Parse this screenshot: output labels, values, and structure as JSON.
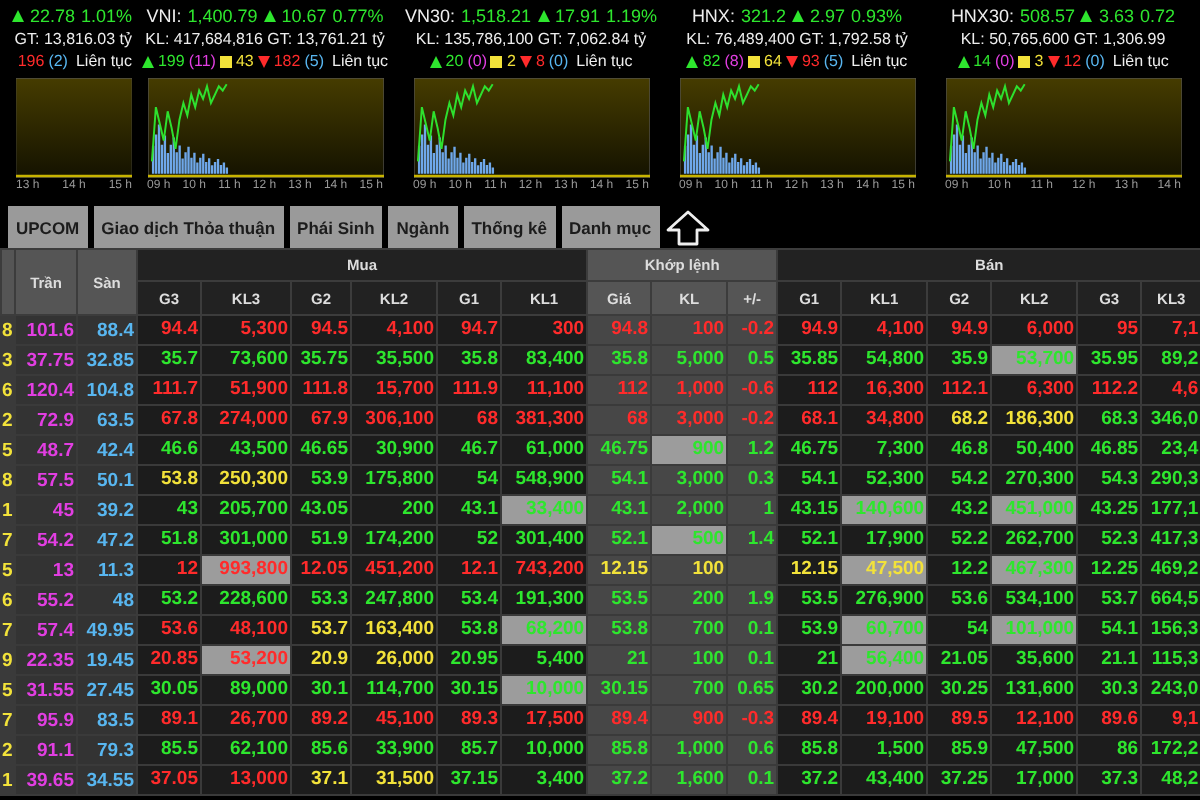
{
  "indices": [
    {
      "change": "22.78",
      "pct": "1.01%",
      "rising": true,
      "volume_line": "GT: 13,816.03 tỷ",
      "down": "196",
      "floor_count": "(2)",
      "status": "Liên tục",
      "times": [
        "13 h",
        "14 h",
        "15 h"
      ]
    },
    {
      "name": "VNI:",
      "value": "1,400.79",
      "rising": true,
      "change": "10.67",
      "pct": "0.77%",
      "volume_line": "KL: 417,684,816 GT: 13,761.21 tỷ",
      "up": "199",
      "ceil_count": "(11)",
      "flat": "43",
      "down": "182",
      "floor_count": "(5)",
      "status": "Liên tục",
      "times": [
        "09 h",
        "10 h",
        "11 h",
        "12 h",
        "13 h",
        "14 h",
        "15 h"
      ]
    },
    {
      "name": "VN30:",
      "value": "1,518.21",
      "rising": true,
      "change": "17.91",
      "pct": "1.19%",
      "volume_line": "KL: 135,786,100 GT: 7,062.84 tỷ",
      "up": "20",
      "ceil_count": "(0)",
      "flat": "2",
      "down": "8",
      "floor_count": "(0)",
      "status": "Liên tục",
      "times": [
        "09 h",
        "10 h",
        "11 h",
        "12 h",
        "13 h",
        "14 h",
        "15 h"
      ]
    },
    {
      "name": "HNX:",
      "value": "321.2",
      "rising": true,
      "change": "2.97",
      "pct": "0.93%",
      "volume_line": "KL: 76,489,400 GT: 1,792.58 tỷ",
      "up": "82",
      "ceil_count": "(8)",
      "flat": "64",
      "down": "93",
      "floor_count": "(5)",
      "status": "Liên tục",
      "times": [
        "09 h",
        "10 h",
        "11 h",
        "12 h",
        "13 h",
        "14 h",
        "15 h"
      ]
    },
    {
      "name": "HNX30:",
      "value": "508.57",
      "rising": true,
      "change": "3.63",
      "pct": "0.72",
      "volume_line": "KL: 50,765,600 GT: 1,306.99",
      "up": "14",
      "ceil_count": "(0)",
      "flat": "3",
      "down": "12",
      "floor_count": "(0)",
      "status": "Liên tục",
      "times": [
        "09 h",
        "10 h",
        "11 h",
        "12 h",
        "13 h",
        "14 h"
      ]
    }
  ],
  "tabs": [
    "UPCOM",
    "Giao dịch Thỏa thuận",
    "Phái Sinh",
    "Ngành",
    "Thống kê",
    "Danh mục"
  ],
  "table": {
    "ceiling_label": "Trần",
    "floor_label": "Sàn",
    "groups": [
      {
        "label": "Mua",
        "kind": "bid",
        "columns": [
          "G3",
          "KL3",
          "G2",
          "KL2",
          "G1",
          "KL1"
        ]
      },
      {
        "label": "Khớp lệnh",
        "kind": "match",
        "columns": [
          "Giá",
          "KL",
          "+/-"
        ]
      },
      {
        "label": "Bán",
        "kind": "ask",
        "columns": [
          "G1",
          "KL1",
          "G2",
          "KL2",
          "G3",
          "KL3"
        ]
      }
    ],
    "rows": [
      {
        "column_1": "8",
        "ceiling": "101.6",
        "floor": "88.4",
        "cells": [
          {
            "v": "94.4",
            "color": "#ff2b2b"
          },
          {
            "v": "5,300",
            "color": "#ff2b2b"
          },
          {
            "v": "94.5",
            "color": "#ff2b2b"
          },
          {
            "v": "4,100",
            "color": "#ff2b2b"
          },
          {
            "v": "94.7",
            "color": "#ff2b2b"
          },
          {
            "v": "300",
            "color": "#ff2b2b"
          },
          {
            "v": "94.8",
            "color": "#ff2b2b"
          },
          {
            "v": "100",
            "color": "#ff2b2b"
          },
          {
            "v": "-0.2",
            "color": "#ff2b2b"
          },
          {
            "v": "94.9",
            "color": "#ff2b2b"
          },
          {
            "v": "4,100",
            "color": "#ff2b2b"
          },
          {
            "v": "94.9",
            "color": "#ff2b2b"
          },
          {
            "v": "6,000",
            "color": "#ff2b2b"
          },
          {
            "v": "95",
            "color": "#ff2b2b"
          },
          {
            "v": "7,1",
            "color": "#ff2b2b"
          }
        ]
      },
      {
        "column_1": "3",
        "ceiling": "37.75",
        "floor": "32.85",
        "cells": [
          {
            "v": "35.7",
            "color": "#2ee62e"
          },
          {
            "v": "73,600",
            "color": "#2ee62e"
          },
          {
            "v": "35.75",
            "color": "#2ee62e"
          },
          {
            "v": "35,500",
            "color": "#2ee62e"
          },
          {
            "v": "35.8",
            "color": "#2ee62e"
          },
          {
            "v": "83,400",
            "color": "#2ee62e"
          },
          {
            "v": "35.8",
            "color": "#2ee62e"
          },
          {
            "v": "5,000",
            "color": "#2ee62e"
          },
          {
            "v": "0.5",
            "color": "#2ee62e"
          },
          {
            "v": "35.85",
            "color": "#2ee62e"
          },
          {
            "v": "54,800",
            "color": "#2ee62e"
          },
          {
            "v": "35.9",
            "color": "#2ee62e"
          },
          {
            "v": "53,700",
            "color": "#2ee62e",
            "hl": true
          },
          {
            "v": "35.95",
            "color": "#2ee62e"
          },
          {
            "v": "89,2",
            "color": "#2ee62e"
          }
        ]
      },
      {
        "column_1": "6",
        "ceiling": "120.4",
        "floor": "104.8",
        "cells": [
          {
            "v": "111.7",
            "color": "#ff2b2b"
          },
          {
            "v": "51,900",
            "color": "#ff2b2b"
          },
          {
            "v": "111.8",
            "color": "#ff2b2b"
          },
          {
            "v": "15,700",
            "color": "#ff2b2b"
          },
          {
            "v": "111.9",
            "color": "#ff2b2b"
          },
          {
            "v": "11,100",
            "color": "#ff2b2b"
          },
          {
            "v": "112",
            "color": "#ff2b2b"
          },
          {
            "v": "1,000",
            "color": "#ff2b2b"
          },
          {
            "v": "-0.6",
            "color": "#ff2b2b"
          },
          {
            "v": "112",
            "color": "#ff2b2b"
          },
          {
            "v": "16,300",
            "color": "#ff2b2b"
          },
          {
            "v": "112.1",
            "color": "#ff2b2b"
          },
          {
            "v": "6,300",
            "color": "#ff2b2b"
          },
          {
            "v": "112.2",
            "color": "#ff2b2b"
          },
          {
            "v": "4,6",
            "color": "#ff2b2b"
          }
        ]
      },
      {
        "column_1": "2",
        "ceiling": "72.9",
        "floor": "63.5",
        "cells": [
          {
            "v": "67.8",
            "color": "#ff2b2b"
          },
          {
            "v": "274,000",
            "color": "#ff2b2b"
          },
          {
            "v": "67.9",
            "color": "#ff2b2b"
          },
          {
            "v": "306,100",
            "color": "#ff2b2b"
          },
          {
            "v": "68",
            "color": "#ff2b2b"
          },
          {
            "v": "381,300",
            "color": "#ff2b2b"
          },
          {
            "v": "68",
            "color": "#ff2b2b"
          },
          {
            "v": "3,000",
            "color": "#ff2b2b"
          },
          {
            "v": "-0.2",
            "color": "#ff2b2b"
          },
          {
            "v": "68.1",
            "color": "#ff2b2b"
          },
          {
            "v": "34,800",
            "color": "#ff2b2b"
          },
          {
            "v": "68.2",
            "color": "#f2e23a"
          },
          {
            "v": "186,300",
            "color": "#f2e23a"
          },
          {
            "v": "68.3",
            "color": "#2ee62e"
          },
          {
            "v": "346,0",
            "color": "#2ee62e"
          }
        ]
      },
      {
        "column_1": "5",
        "ceiling": "48.7",
        "floor": "42.4",
        "cells": [
          {
            "v": "46.6",
            "color": "#2ee62e"
          },
          {
            "v": "43,500",
            "color": "#2ee62e"
          },
          {
            "v": "46.65",
            "color": "#2ee62e"
          },
          {
            "v": "30,900",
            "color": "#2ee62e"
          },
          {
            "v": "46.7",
            "color": "#2ee62e"
          },
          {
            "v": "61,000",
            "color": "#2ee62e"
          },
          {
            "v": "46.75",
            "color": "#2ee62e"
          },
          {
            "v": "900",
            "color": "#2ee62e",
            "hl": true
          },
          {
            "v": "1.2",
            "color": "#2ee62e"
          },
          {
            "v": "46.75",
            "color": "#2ee62e"
          },
          {
            "v": "7,300",
            "color": "#2ee62e"
          },
          {
            "v": "46.8",
            "color": "#2ee62e"
          },
          {
            "v": "50,400",
            "color": "#2ee62e"
          },
          {
            "v": "46.85",
            "color": "#2ee62e"
          },
          {
            "v": "23,4",
            "color": "#2ee62e"
          }
        ]
      },
      {
        "column_1": "8",
        "ceiling": "57.5",
        "floor": "50.1",
        "cells": [
          {
            "v": "53.8",
            "color": "#f2e23a"
          },
          {
            "v": "250,300",
            "color": "#f2e23a"
          },
          {
            "v": "53.9",
            "color": "#2ee62e"
          },
          {
            "v": "175,800",
            "color": "#2ee62e"
          },
          {
            "v": "54",
            "color": "#2ee62e"
          },
          {
            "v": "548,900",
            "color": "#2ee62e"
          },
          {
            "v": "54.1",
            "color": "#2ee62e"
          },
          {
            "v": "3,000",
            "color": "#2ee62e"
          },
          {
            "v": "0.3",
            "color": "#2ee62e"
          },
          {
            "v": "54.1",
            "color": "#2ee62e"
          },
          {
            "v": "52,300",
            "color": "#2ee62e"
          },
          {
            "v": "54.2",
            "color": "#2ee62e"
          },
          {
            "v": "270,300",
            "color": "#2ee62e"
          },
          {
            "v": "54.3",
            "color": "#2ee62e"
          },
          {
            "v": "290,3",
            "color": "#2ee62e"
          }
        ]
      },
      {
        "column_1": "1",
        "ceiling": "45",
        "floor": "39.2",
        "cells": [
          {
            "v": "43",
            "color": "#2ee62e"
          },
          {
            "v": "205,700",
            "color": "#2ee62e"
          },
          {
            "v": "43.05",
            "color": "#2ee62e"
          },
          {
            "v": "200",
            "color": "#2ee62e"
          },
          {
            "v": "43.1",
            "color": "#2ee62e"
          },
          {
            "v": "33,400",
            "color": "#2ee62e",
            "hl": true
          },
          {
            "v": "43.1",
            "color": "#2ee62e"
          },
          {
            "v": "2,000",
            "color": "#2ee62e"
          },
          {
            "v": "1",
            "color": "#2ee62e"
          },
          {
            "v": "43.15",
            "color": "#2ee62e"
          },
          {
            "v": "140,600",
            "color": "#2ee62e",
            "hl": true
          },
          {
            "v": "43.2",
            "color": "#2ee62e"
          },
          {
            "v": "451,000",
            "color": "#2ee62e",
            "hl": true
          },
          {
            "v": "43.25",
            "color": "#2ee62e"
          },
          {
            "v": "177,1",
            "color": "#2ee62e"
          }
        ]
      },
      {
        "column_1": "7",
        "ceiling": "54.2",
        "floor": "47.2",
        "cells": [
          {
            "v": "51.8",
            "color": "#2ee62e"
          },
          {
            "v": "301,000",
            "color": "#2ee62e"
          },
          {
            "v": "51.9",
            "color": "#2ee62e"
          },
          {
            "v": "174,200",
            "color": "#2ee62e"
          },
          {
            "v": "52",
            "color": "#2ee62e"
          },
          {
            "v": "301,400",
            "color": "#2ee62e"
          },
          {
            "v": "52.1",
            "color": "#2ee62e"
          },
          {
            "v": "500",
            "color": "#2ee62e",
            "hl": true
          },
          {
            "v": "1.4",
            "color": "#2ee62e"
          },
          {
            "v": "52.1",
            "color": "#2ee62e"
          },
          {
            "v": "17,900",
            "color": "#2ee62e"
          },
          {
            "v": "52.2",
            "color": "#2ee62e"
          },
          {
            "v": "262,700",
            "color": "#2ee62e"
          },
          {
            "v": "52.3",
            "color": "#2ee62e"
          },
          {
            "v": "417,3",
            "color": "#2ee62e"
          }
        ]
      },
      {
        "column_1": "5",
        "ceiling": "13",
        "floor": "11.3",
        "cells": [
          {
            "v": "12",
            "color": "#ff2b2b"
          },
          {
            "v": "993,800",
            "color": "#ff2b2b",
            "hl": true
          },
          {
            "v": "12.05",
            "color": "#ff2b2b"
          },
          {
            "v": "451,200",
            "color": "#ff2b2b"
          },
          {
            "v": "12.1",
            "color": "#ff2b2b"
          },
          {
            "v": "743,200",
            "color": "#ff2b2b"
          },
          {
            "v": "12.15",
            "color": "#f2e23a"
          },
          {
            "v": "100",
            "color": "#f2e23a"
          },
          {},
          {
            "v": "12.15",
            "color": "#f2e23a"
          },
          {
            "v": "47,500",
            "color": "#f2e23a",
            "hl": true
          },
          {
            "v": "12.2",
            "color": "#2ee62e"
          },
          {
            "v": "467,300",
            "color": "#2ee62e",
            "hl": true
          },
          {
            "v": "12.25",
            "color": "#2ee62e"
          },
          {
            "v": "469,2",
            "color": "#2ee62e"
          }
        ]
      },
      {
        "column_1": "6",
        "ceiling": "55.2",
        "floor": "48",
        "cells": [
          {
            "v": "53.2",
            "color": "#2ee62e"
          },
          {
            "v": "228,600",
            "color": "#2ee62e"
          },
          {
            "v": "53.3",
            "color": "#2ee62e"
          },
          {
            "v": "247,800",
            "color": "#2ee62e"
          },
          {
            "v": "53.4",
            "color": "#2ee62e"
          },
          {
            "v": "191,300",
            "color": "#2ee62e"
          },
          {
            "v": "53.5",
            "color": "#2ee62e"
          },
          {
            "v": "200",
            "color": "#2ee62e"
          },
          {
            "v": "1.9",
            "color": "#2ee62e"
          },
          {
            "v": "53.5",
            "color": "#2ee62e"
          },
          {
            "v": "276,900",
            "color": "#2ee62e"
          },
          {
            "v": "53.6",
            "color": "#2ee62e"
          },
          {
            "v": "534,100",
            "color": "#2ee62e"
          },
          {
            "v": "53.7",
            "color": "#2ee62e"
          },
          {
            "v": "664,5",
            "color": "#2ee62e"
          }
        ]
      },
      {
        "column_1": "7",
        "ceiling": "57.4",
        "floor": "49.95",
        "cells": [
          {
            "v": "53.6",
            "color": "#ff2b2b"
          },
          {
            "v": "48,100",
            "color": "#ff2b2b"
          },
          {
            "v": "53.7",
            "color": "#f2e23a"
          },
          {
            "v": "163,400",
            "color": "#f2e23a"
          },
          {
            "v": "53.8",
            "color": "#2ee62e"
          },
          {
            "v": "68,200",
            "color": "#2ee62e",
            "hl": true
          },
          {
            "v": "53.8",
            "color": "#2ee62e"
          },
          {
            "v": "700",
            "color": "#2ee62e"
          },
          {
            "v": "0.1",
            "color": "#2ee62e"
          },
          {
            "v": "53.9",
            "color": "#2ee62e"
          },
          {
            "v": "60,700",
            "color": "#2ee62e",
            "hl": true
          },
          {
            "v": "54",
            "color": "#2ee62e"
          },
          {
            "v": "101,000",
            "color": "#2ee62e",
            "hl": true
          },
          {
            "v": "54.1",
            "color": "#2ee62e"
          },
          {
            "v": "156,3",
            "color": "#2ee62e"
          }
        ]
      },
      {
        "column_1": "9",
        "ceiling": "22.35",
        "floor": "19.45",
        "cells": [
          {
            "v": "20.85",
            "color": "#ff2b2b"
          },
          {
            "v": "53,200",
            "color": "#ff2b2b",
            "hl": true
          },
          {
            "v": "20.9",
            "color": "#f2e23a"
          },
          {
            "v": "26,000",
            "color": "#f2e23a"
          },
          {
            "v": "20.95",
            "color": "#2ee62e"
          },
          {
            "v": "5,400",
            "color": "#2ee62e"
          },
          {
            "v": "21",
            "color": "#2ee62e"
          },
          {
            "v": "100",
            "color": "#2ee62e"
          },
          {
            "v": "0.1",
            "color": "#2ee62e"
          },
          {
            "v": "21",
            "color": "#2ee62e"
          },
          {
            "v": "56,400",
            "color": "#2ee62e",
            "hl": true
          },
          {
            "v": "21.05",
            "color": "#2ee62e"
          },
          {
            "v": "35,600",
            "color": "#2ee62e"
          },
          {
            "v": "21.1",
            "color": "#2ee62e"
          },
          {
            "v": "115,3",
            "color": "#2ee62e"
          }
        ]
      },
      {
        "column_1": "5",
        "ceiling": "31.55",
        "floor": "27.45",
        "cells": [
          {
            "v": "30.05",
            "color": "#2ee62e"
          },
          {
            "v": "89,000",
            "color": "#2ee62e"
          },
          {
            "v": "30.1",
            "color": "#2ee62e"
          },
          {
            "v": "114,700",
            "color": "#2ee62e"
          },
          {
            "v": "30.15",
            "color": "#2ee62e"
          },
          {
            "v": "10,000",
            "color": "#2ee62e",
            "hl": true
          },
          {
            "v": "30.15",
            "color": "#2ee62e"
          },
          {
            "v": "700",
            "color": "#2ee62e"
          },
          {
            "v": "0.65",
            "color": "#2ee62e"
          },
          {
            "v": "30.2",
            "color": "#2ee62e"
          },
          {
            "v": "200,000",
            "color": "#2ee62e"
          },
          {
            "v": "30.25",
            "color": "#2ee62e"
          },
          {
            "v": "131,600",
            "color": "#2ee62e"
          },
          {
            "v": "30.3",
            "color": "#2ee62e"
          },
          {
            "v": "243,0",
            "color": "#2ee62e"
          }
        ]
      },
      {
        "column_1": "7",
        "ceiling": "95.9",
        "floor": "83.5",
        "cells": [
          {
            "v": "89.1",
            "color": "#ff2b2b"
          },
          {
            "v": "26,700",
            "color": "#ff2b2b"
          },
          {
            "v": "89.2",
            "color": "#ff2b2b"
          },
          {
            "v": "45,100",
            "color": "#ff2b2b"
          },
          {
            "v": "89.3",
            "color": "#ff2b2b"
          },
          {
            "v": "17,500",
            "color": "#ff2b2b"
          },
          {
            "v": "89.4",
            "color": "#ff2b2b"
          },
          {
            "v": "900",
            "color": "#ff2b2b"
          },
          {
            "v": "-0.3",
            "color": "#ff2b2b"
          },
          {
            "v": "89.4",
            "color": "#ff2b2b"
          },
          {
            "v": "19,100",
            "color": "#ff2b2b"
          },
          {
            "v": "89.5",
            "color": "#ff2b2b"
          },
          {
            "v": "12,100",
            "color": "#ff2b2b"
          },
          {
            "v": "89.6",
            "color": "#ff2b2b"
          },
          {
            "v": "9,1",
            "color": "#ff2b2b"
          }
        ]
      },
      {
        "column_1": "2",
        "ceiling": "91.1",
        "floor": "79.3",
        "cells": [
          {
            "v": "85.5",
            "color": "#2ee62e"
          },
          {
            "v": "62,100",
            "color": "#2ee62e"
          },
          {
            "v": "85.6",
            "color": "#2ee62e"
          },
          {
            "v": "33,900",
            "color": "#2ee62e"
          },
          {
            "v": "85.7",
            "color": "#2ee62e"
          },
          {
            "v": "10,000",
            "color": "#2ee62e"
          },
          {
            "v": "85.8",
            "color": "#2ee62e"
          },
          {
            "v": "1,000",
            "color": "#2ee62e"
          },
          {
            "v": "0.6",
            "color": "#2ee62e"
          },
          {
            "v": "85.8",
            "color": "#2ee62e"
          },
          {
            "v": "1,500",
            "color": "#2ee62e"
          },
          {
            "v": "85.9",
            "color": "#2ee62e"
          },
          {
            "v": "47,500",
            "color": "#2ee62e"
          },
          {
            "v": "86",
            "color": "#2ee62e"
          },
          {
            "v": "172,2",
            "color": "#2ee62e"
          }
        ]
      },
      {
        "column_1": "1",
        "ceiling": "39.65",
        "floor": "34.55",
        "cells": [
          {
            "v": "37.05",
            "color": "#ff2b2b"
          },
          {
            "v": "13,000",
            "color": "#ff2b2b"
          },
          {
            "v": "37.1",
            "color": "#f2e23a"
          },
          {
            "v": "31,500",
            "color": "#f2e23a"
          },
          {
            "v": "37.15",
            "color": "#2ee62e"
          },
          {
            "v": "3,400",
            "color": "#2ee62e"
          },
          {
            "v": "37.2",
            "color": "#2ee62e"
          },
          {
            "v": "1,600",
            "color": "#2ee62e"
          },
          {
            "v": "0.1",
            "color": "#2ee62e"
          },
          {
            "v": "37.2",
            "color": "#2ee62e"
          },
          {
            "v": "43,400",
            "color": "#2ee62e"
          },
          {
            "v": "37.25",
            "color": "#2ee62e"
          },
          {
            "v": "17,000",
            "color": "#2ee62e"
          },
          {
            "v": "37.3",
            "color": "#2ee62e"
          },
          {
            "v": "48,2",
            "color": "#2ee62e"
          }
        ]
      }
    ]
  }
}
